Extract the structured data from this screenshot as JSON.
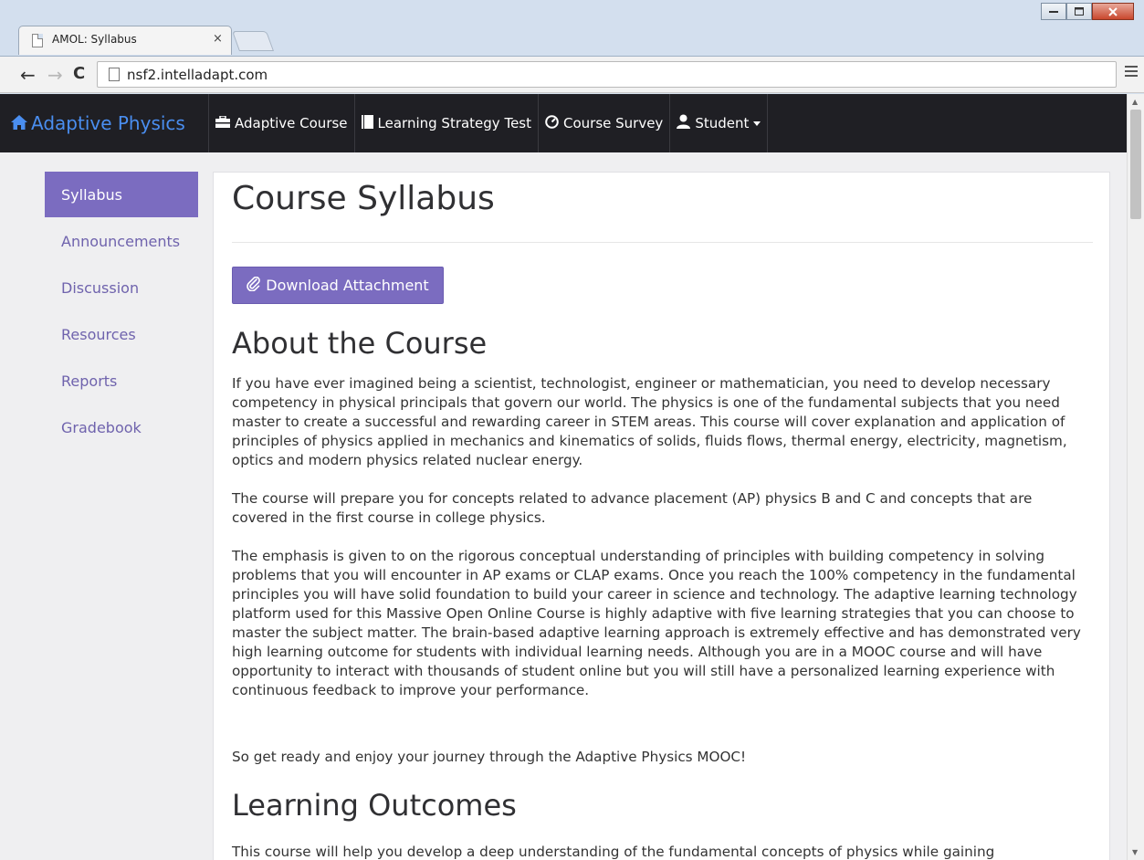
{
  "browser": {
    "tab_title": "AMOL: Syllabus",
    "tab_close": "×",
    "url": "nsf2.intelladapt.com"
  },
  "navbar": {
    "brand": "Adaptive Physics",
    "items": [
      {
        "label": "Adaptive Course",
        "icon": "briefcase-icon"
      },
      {
        "label": "Learning Strategy Test",
        "icon": "book-icon"
      },
      {
        "label": "Course Survey",
        "icon": "dashboard-icon"
      },
      {
        "label": "Student",
        "icon": "user-icon"
      }
    ]
  },
  "sidebar": {
    "items": [
      {
        "label": "Syllabus",
        "active": true
      },
      {
        "label": "Announcements"
      },
      {
        "label": "Discussion"
      },
      {
        "label": "Resources"
      },
      {
        "label": "Reports"
      },
      {
        "label": "Gradebook"
      }
    ]
  },
  "main": {
    "title": "Course Syllabus",
    "download_label": "Download Attachment",
    "about_heading": "About the Course",
    "about_paragraphs": [
      "If you have ever imagined being a scientist, technologist, engineer or mathematician, you need to develop necessary competency in physical principals that govern our world. The physics is one of the fundamental subjects that you need master to create a successful and rewarding career in STEM areas. This course will cover explanation and application of principles of physics applied in mechanics and kinematics of solids, fluids flows, thermal energy, electricity, magnetism, optics and modern physics related nuclear energy.",
      "The course will prepare you for concepts related to advance placement (AP) physics B and C and concepts that are covered in the first course in college physics.",
      "The emphasis is given to on the rigorous conceptual understanding of principles with building competency in solving problems that you will encounter in AP exams or CLAP exams. Once you reach the 100% competency in the fundamental principles you will have solid foundation to build your career in science and technology. The adaptive learning technology platform used for this Massive Open Online Course is highly adaptive with five learning strategies that you can choose to master the subject matter. The brain-based adaptive learning approach is extremely effective and has demonstrated very high learning outcome for students with individual learning needs. Although you are in a MOOC course and will have opportunity to interact with thousands of student online but you will still have a personalized learning experience with continuous feedback to improve your performance.",
      "So get ready and enjoy your journey through the Adaptive Physics MOOC!"
    ],
    "outcomes_heading": "Learning Outcomes",
    "outcomes_paragraph": "This course will help you develop a deep understanding of the fundamental concepts of physics while gaining"
  },
  "colors": {
    "navbar_bg": "#1f1f24",
    "brand": "#4a8ef0",
    "accent": "#7b6cc0",
    "sidebar_link": "#6f63ad"
  }
}
